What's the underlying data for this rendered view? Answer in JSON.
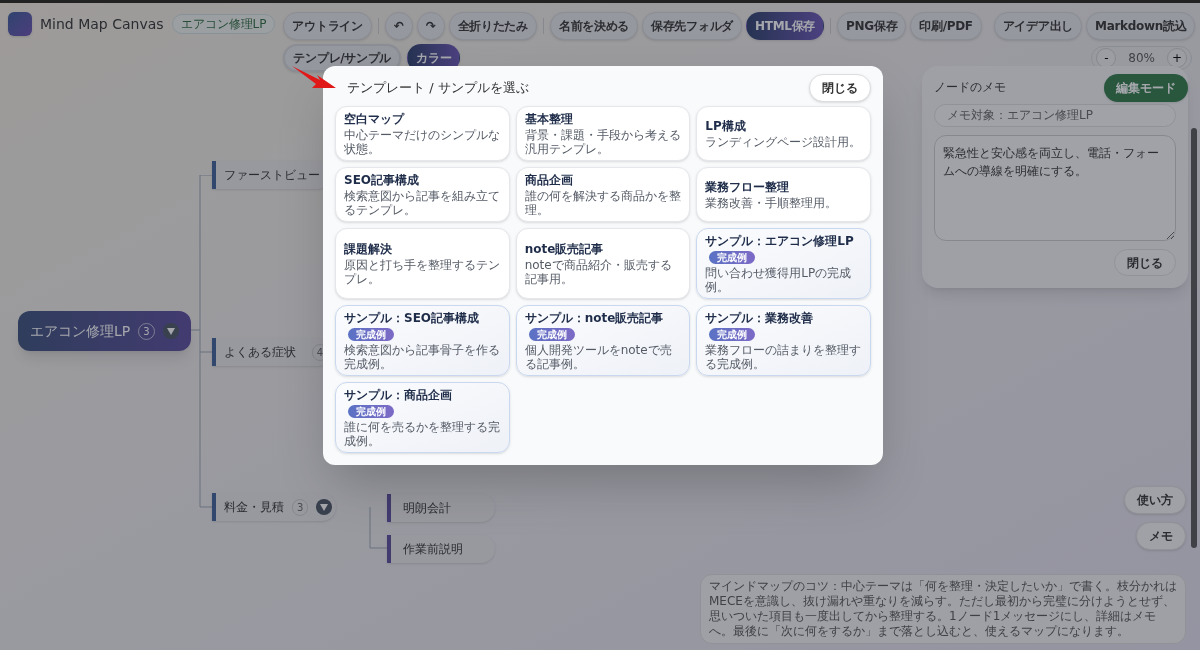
{
  "app": {
    "title": "Mind Map Canvas",
    "map_name": "エアコン修理LP"
  },
  "toolbar": {
    "row1": [
      {
        "label": "アウトライン",
        "kind": "text"
      },
      {
        "label": "↶",
        "kind": "icon"
      },
      {
        "label": "↷",
        "kind": "icon"
      },
      {
        "label": "全折りたたみ",
        "kind": "text"
      },
      {
        "label": "名前を決める",
        "kind": "text"
      },
      {
        "label": "保存先フォルダ",
        "kind": "text"
      },
      {
        "label": "HTML保存",
        "kind": "primary"
      },
      {
        "label": "PNG保存",
        "kind": "text"
      },
      {
        "label": "印刷/PDF",
        "kind": "text"
      },
      {
        "label": "アイデア出し",
        "kind": "text"
      },
      {
        "label": "Markdown読込",
        "kind": "text"
      }
    ],
    "row2": [
      {
        "label": "テンプレ/サンプル",
        "kind": "text",
        "selected": true
      },
      {
        "label": "カラー",
        "kind": "primary",
        "selected": false
      }
    ],
    "zoom": {
      "minus": "-",
      "value": "80%",
      "plus": "+"
    }
  },
  "mind_map": {
    "root": {
      "label": "エアコン修理LP",
      "count": "3",
      "collapsible": true
    },
    "branches": [
      {
        "label": "ファーストビュー",
        "collapsible": false
      },
      {
        "label": "よくある症状",
        "count": "4",
        "collapsible": false
      },
      {
        "label": "料金・見積",
        "count": "3",
        "collapsible": true,
        "children": [
          {
            "label": "明朗会計"
          },
          {
            "label": "作業前説明"
          }
        ]
      }
    ]
  },
  "template_dialog": {
    "title": "テンプレート / サンプルを選ぶ",
    "close": "閉じる",
    "cards": [
      {
        "kind": "template",
        "title": "空白マップ",
        "description": "中心テーマだけのシンプルな状態。"
      },
      {
        "kind": "template",
        "title": "基本整理",
        "description": "背景・課題・手段から考える汎用テンプレ。"
      },
      {
        "kind": "template",
        "title": "LP構成",
        "description": "ランディングページ設計用。"
      },
      {
        "kind": "template",
        "title": "SEO記事構成",
        "description": "検索意図から記事を組み立てるテンプレ。"
      },
      {
        "kind": "template",
        "title": "商品企画",
        "description": "誰の何を解決する商品かを整理。"
      },
      {
        "kind": "template",
        "title": "業務フロー整理",
        "description": "業務改善・手順整理用。"
      },
      {
        "kind": "template",
        "title": "課題解決",
        "description": "原因と打ち手を整理するテンプレ。"
      },
      {
        "kind": "template",
        "title": "note販売記事",
        "description": "noteで商品紹介・販売する記事用。"
      },
      {
        "kind": "sample",
        "title": "サンプル：エアコン修理LP",
        "badge": "完成例",
        "description": "問い合わせ獲得用LPの完成例。"
      },
      {
        "kind": "sample",
        "title": "サンプル：SEO記事構成",
        "badge": "完成例",
        "description": "検索意図から記事骨子を作る完成例。"
      },
      {
        "kind": "sample",
        "title": "サンプル：note販売記事",
        "badge": "完成例",
        "description": "個人開発ツールをnoteで売る記事例。"
      },
      {
        "kind": "sample",
        "title": "サンプル：業務改善",
        "badge": "完成例",
        "description": "業務フローの詰まりを整理する完成例。"
      },
      {
        "kind": "sample",
        "title": "サンプル：商品企画",
        "badge": "完成例",
        "description": "誰に何を売るかを整理する完成例。"
      }
    ]
  },
  "memo_panel": {
    "title": "ノードのメモ",
    "target": "メモ対象：エアコン修理LP",
    "text": "緊急性と安心感を両立し、電話・フォームへの導線を明確にする。",
    "close": "閉じる"
  },
  "mode_button": "編集モード",
  "side_buttons": [
    "使い方",
    "メモ"
  ],
  "tip": "マインドマップのコツ：中心テーマは「何を整理・決定したいか」で書く。枝分かれはMECEを意識し、抜け漏れや重なりを減らす。ただし最初から完璧に分けようとせず、思いついた項目も一度出してから整理する。1ノード1メッセージにし、詳細はメモへ。最後に「次に何をするか」まで落とし込むと、使えるマップになります。"
}
